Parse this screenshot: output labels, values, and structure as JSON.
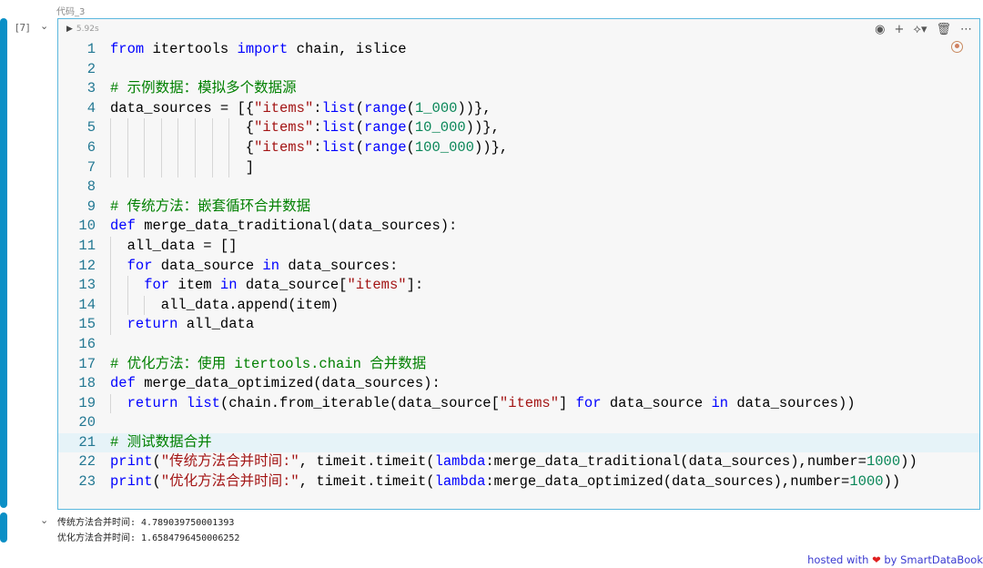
{
  "cell": {
    "name": "代码_3",
    "exec_count": "[7]",
    "duration": "5.92s"
  },
  "toolbar": {
    "icons": [
      "eye-icon",
      "plus-icon",
      "python-icon",
      "trash-icon",
      "more-icon"
    ],
    "glyphs": [
      "◉",
      "+",
      "⟡▾",
      "🗑",
      "⋯"
    ]
  },
  "code": {
    "highlight_line": 21,
    "lines": [
      {
        "indent": 0,
        "tokens": [
          [
            "kw",
            "from"
          ],
          [
            "txt",
            " itertools "
          ],
          [
            "kw",
            "import"
          ],
          [
            "txt",
            " chain, islice"
          ]
        ]
      },
      {
        "indent": 0,
        "tokens": []
      },
      {
        "indent": 0,
        "tokens": [
          [
            "com",
            "# 示例数据：模拟多个数据源"
          ]
        ]
      },
      {
        "indent": 0,
        "tokens": [
          [
            "txt",
            "data_sources = [{"
          ],
          [
            "str",
            "\"items\""
          ],
          [
            "txt",
            ":"
          ],
          [
            "kw",
            "list"
          ],
          [
            "txt",
            "("
          ],
          [
            "kw",
            "range"
          ],
          [
            "txt",
            "("
          ],
          [
            "num",
            "1_000"
          ],
          [
            "txt",
            "))},"
          ]
        ]
      },
      {
        "indent": 8,
        "tokens": [
          [
            "txt",
            "{"
          ],
          [
            "str",
            "\"items\""
          ],
          [
            "txt",
            ":"
          ],
          [
            "kw",
            "list"
          ],
          [
            "txt",
            "("
          ],
          [
            "kw",
            "range"
          ],
          [
            "txt",
            "("
          ],
          [
            "num",
            "10_000"
          ],
          [
            "txt",
            "))},"
          ]
        ]
      },
      {
        "indent": 8,
        "tokens": [
          [
            "txt",
            "{"
          ],
          [
            "str",
            "\"items\""
          ],
          [
            "txt",
            ":"
          ],
          [
            "kw",
            "list"
          ],
          [
            "txt",
            "("
          ],
          [
            "kw",
            "range"
          ],
          [
            "txt",
            "("
          ],
          [
            "num",
            "100_000"
          ],
          [
            "txt",
            "))},"
          ]
        ]
      },
      {
        "indent": 8,
        "tokens": [
          [
            "txt",
            "]"
          ]
        ]
      },
      {
        "indent": 0,
        "tokens": []
      },
      {
        "indent": 0,
        "tokens": [
          [
            "com",
            "# 传统方法：嵌套循环合并数据"
          ]
        ]
      },
      {
        "indent": 0,
        "tokens": [
          [
            "kw",
            "def"
          ],
          [
            "txt",
            " merge_data_traditional(data_sources):"
          ]
        ]
      },
      {
        "indent": 1,
        "tokens": [
          [
            "txt",
            "all_data = []"
          ]
        ]
      },
      {
        "indent": 1,
        "tokens": [
          [
            "kw",
            "for"
          ],
          [
            "txt",
            " data_source "
          ],
          [
            "kw",
            "in"
          ],
          [
            "txt",
            " data_sources:"
          ]
        ]
      },
      {
        "indent": 2,
        "tokens": [
          [
            "kw",
            "for"
          ],
          [
            "txt",
            " item "
          ],
          [
            "kw",
            "in"
          ],
          [
            "txt",
            " data_source["
          ],
          [
            "str",
            "\"items\""
          ],
          [
            "txt",
            "]:"
          ]
        ]
      },
      {
        "indent": 3,
        "tokens": [
          [
            "txt",
            "all_data.append(item)"
          ]
        ]
      },
      {
        "indent": 1,
        "tokens": [
          [
            "kw",
            "return"
          ],
          [
            "txt",
            " all_data"
          ]
        ]
      },
      {
        "indent": 0,
        "tokens": []
      },
      {
        "indent": 0,
        "tokens": [
          [
            "com",
            "# 优化方法：使用 itertools.chain 合并数据"
          ]
        ]
      },
      {
        "indent": 0,
        "tokens": [
          [
            "kw",
            "def"
          ],
          [
            "txt",
            " merge_data_optimized(data_sources):"
          ]
        ]
      },
      {
        "indent": 1,
        "tokens": [
          [
            "kw",
            "return"
          ],
          [
            "txt",
            " "
          ],
          [
            "kw",
            "list"
          ],
          [
            "txt",
            "(chain.from_iterable(data_source["
          ],
          [
            "str",
            "\"items\""
          ],
          [
            "txt",
            "] "
          ],
          [
            "kw",
            "for"
          ],
          [
            "txt",
            " data_source "
          ],
          [
            "kw",
            "in"
          ],
          [
            "txt",
            " data_sources))"
          ]
        ]
      },
      {
        "indent": 0,
        "tokens": []
      },
      {
        "indent": 0,
        "tokens": [
          [
            "com",
            "# 测试数据合并"
          ]
        ]
      },
      {
        "indent": 0,
        "tokens": [
          [
            "kw",
            "print"
          ],
          [
            "txt",
            "("
          ],
          [
            "str",
            "\"传统方法合并时间:\""
          ],
          [
            "txt",
            ", timeit.timeit("
          ],
          [
            "kw",
            "lambda"
          ],
          [
            "txt",
            ":merge_data_traditional(data_sources),number="
          ],
          [
            "num",
            "1000"
          ],
          [
            "txt",
            "))"
          ]
        ]
      },
      {
        "indent": 0,
        "tokens": [
          [
            "kw",
            "print"
          ],
          [
            "txt",
            "("
          ],
          [
            "str",
            "\"优化方法合并时间:\""
          ],
          [
            "txt",
            ", timeit.timeit("
          ],
          [
            "kw",
            "lambda"
          ],
          [
            "txt",
            ":merge_data_optimized(data_sources),number="
          ],
          [
            "num",
            "1000"
          ],
          [
            "txt",
            "))"
          ]
        ]
      }
    ]
  },
  "output": {
    "lines": [
      "传统方法合并时间: 4.789039750001393",
      "优化方法合并时间: 1.6584796450006252"
    ]
  },
  "footer": {
    "prefix": "hosted with",
    "suffix": "by SmartDataBook"
  }
}
